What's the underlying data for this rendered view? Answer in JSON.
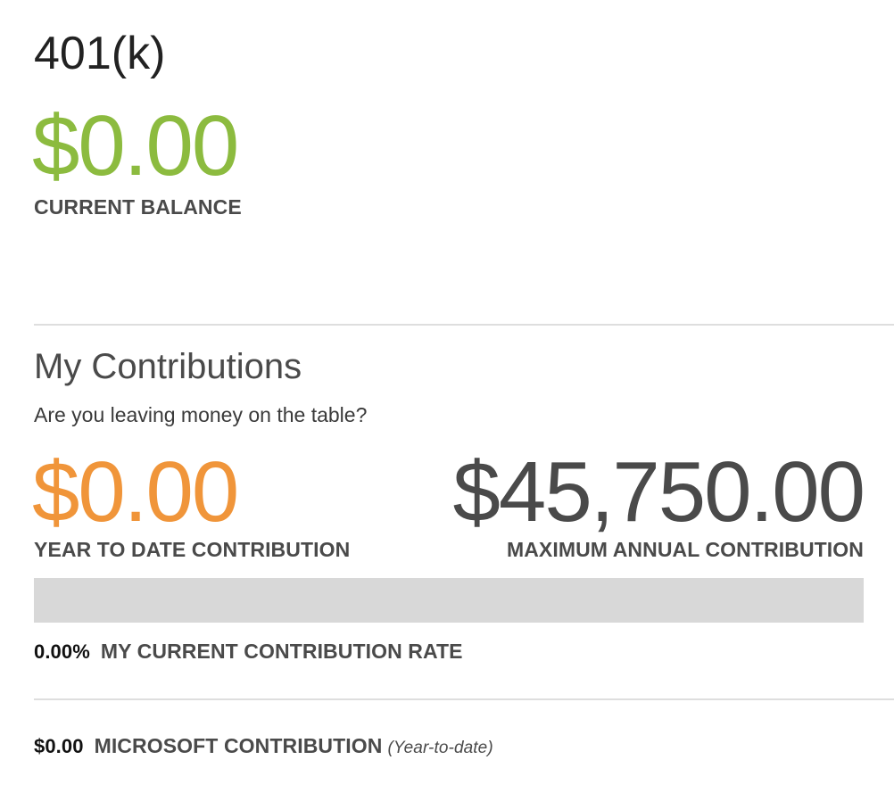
{
  "colors": {
    "balance_green": "#8cbb3f",
    "ytd_orange": "#f0953a",
    "text_dark": "#4a4a4a",
    "track_gray": "#d8d8d8"
  },
  "account": {
    "title": "401(k)",
    "current_balance": "$0.00",
    "current_balance_label": "CURRENT BALANCE"
  },
  "contributions": {
    "title": "My Contributions",
    "subtitle": "Are you leaving money on the table?",
    "ytd_amount": "$0.00",
    "ytd_label": "YEAR TO DATE CONTRIBUTION",
    "max_amount": "$45,750.00",
    "max_label": "MAXIMUM ANNUAL CONTRIBUTION",
    "progress_fraction": 0.0,
    "rate_value": "0.00%",
    "rate_label": "MY CURRENT CONTRIBUTION RATE"
  },
  "employer": {
    "amount": "$0.00",
    "label": "MICROSOFT CONTRIBUTION",
    "note": "(Year-to-date)"
  }
}
